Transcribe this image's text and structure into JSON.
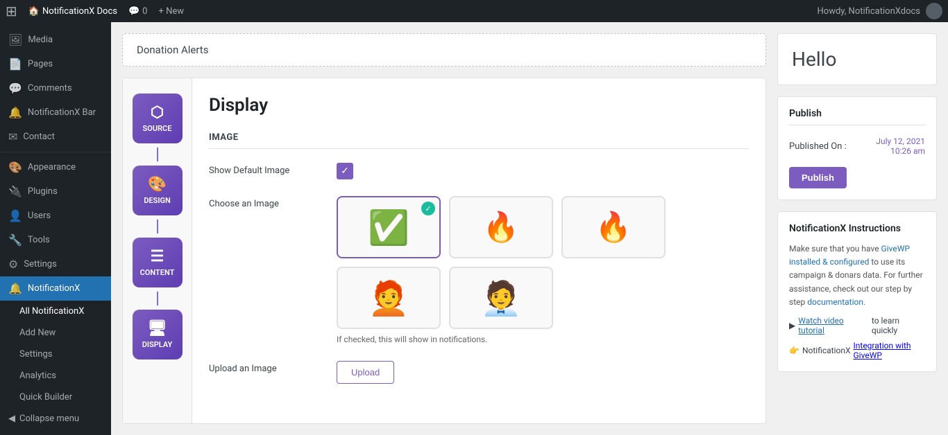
{
  "adminbar": {
    "logo": "🔷",
    "site_name": "NotificationX Docs",
    "comments_label": "Comments",
    "comments_count": "0",
    "new_label": "+ New",
    "howdy": "Howdy, NotificationXdocs"
  },
  "sidebar": {
    "items": [
      {
        "id": "media",
        "label": "Media",
        "icon": "🖼"
      },
      {
        "id": "pages",
        "label": "Pages",
        "icon": "📄"
      },
      {
        "id": "comments",
        "label": "Comments",
        "icon": "💬"
      },
      {
        "id": "notificationx-bar",
        "label": "NotificationX Bar",
        "icon": "🔔"
      },
      {
        "id": "contact",
        "label": "Contact",
        "icon": "✉"
      },
      {
        "id": "appearance",
        "label": "Appearance",
        "icon": "🎨"
      },
      {
        "id": "plugins",
        "label": "Plugins",
        "icon": "🔌"
      },
      {
        "id": "users",
        "label": "Users",
        "icon": "👤"
      },
      {
        "id": "tools",
        "label": "Tools",
        "icon": "🔧"
      },
      {
        "id": "settings",
        "label": "Settings",
        "icon": "⚙"
      },
      {
        "id": "notificationx",
        "label": "NotificationX",
        "icon": "🔔"
      }
    ],
    "submenu": [
      {
        "id": "all-notificationx",
        "label": "All NotificationX",
        "active": true
      },
      {
        "id": "add-new",
        "label": "Add New"
      },
      {
        "id": "settings",
        "label": "Settings"
      },
      {
        "id": "analytics",
        "label": "Analytics"
      },
      {
        "id": "quick-builder",
        "label": "Quick Builder"
      }
    ],
    "collapse_label": "Collapse menu"
  },
  "breadcrumb": "Donation Alerts",
  "steps": [
    {
      "id": "source",
      "label": "SOURCE",
      "icon": "⬡"
    },
    {
      "id": "design",
      "label": "DESIGN",
      "icon": "🎨"
    },
    {
      "id": "content",
      "label": "CONTENT",
      "icon": "☰"
    },
    {
      "id": "display",
      "label": "DISPLAY",
      "icon": "🖥"
    }
  ],
  "display": {
    "title": "Display",
    "section_image": "IMAGE",
    "show_default_image_label": "Show Default Image",
    "choose_image_label": "Choose an Image",
    "hint_text": "If checked, this will show in notifications.",
    "upload_label": "Upload an Image",
    "upload_btn": "Upload",
    "images": [
      {
        "id": "checkmark",
        "emoji": "✅",
        "selected": true
      },
      {
        "id": "fire1",
        "emoji": "🔥",
        "selected": false
      },
      {
        "id": "fire2",
        "emoji": "🔥",
        "selected": false
      },
      {
        "id": "person1",
        "emoji": "👤",
        "selected": false
      },
      {
        "id": "person2",
        "emoji": "👤",
        "selected": false
      }
    ]
  },
  "right_panel": {
    "hello": "Hello",
    "publish_section": "Publish",
    "published_on_label": "Published On :",
    "published_on_date": "July 12, 2021",
    "published_on_time": "10:26 am",
    "publish_btn": "Publish",
    "instructions_title": "NotificationX Instructions",
    "instructions_text_part1": "Make sure that you have ",
    "givewp_link": "GiveWP installed & configured",
    "instructions_text_part2": " to use its campaign & donars data. For further assistance, check out our step by step ",
    "documentation_link": "documentation",
    "watch_label": "Watch video tutorial",
    "watch_text": " to learn quickly",
    "integration_icon": "👉",
    "integration_label": "NotificationX ",
    "integration_link": "Integration with GiveWP"
  }
}
